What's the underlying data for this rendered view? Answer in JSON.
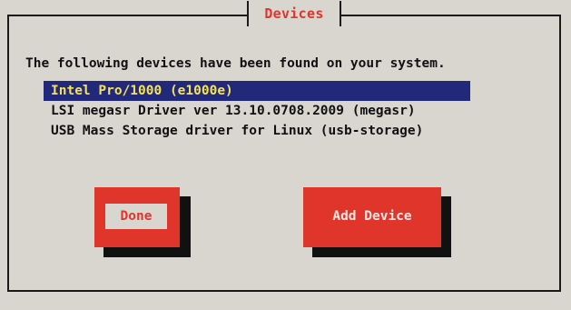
{
  "dialog": {
    "title": "Devices",
    "intro": "The following devices have been found on your system."
  },
  "devices": [
    {
      "label": "Intel Pro/1000 (e1000e)",
      "selected": true
    },
    {
      "label": "LSI megasr Driver ver 13.10.0708.2009 (megasr)",
      "selected": false
    },
    {
      "label": "USB Mass Storage driver for Linux (usb-storage)",
      "selected": false
    }
  ],
  "buttons": {
    "done_label": "Done",
    "add_device_label": "Add Device"
  },
  "colors": {
    "background": "#d9d6d0",
    "accent_red": "#e0352b",
    "selection_bg": "#23297a",
    "selection_fg": "#f4e35a"
  }
}
